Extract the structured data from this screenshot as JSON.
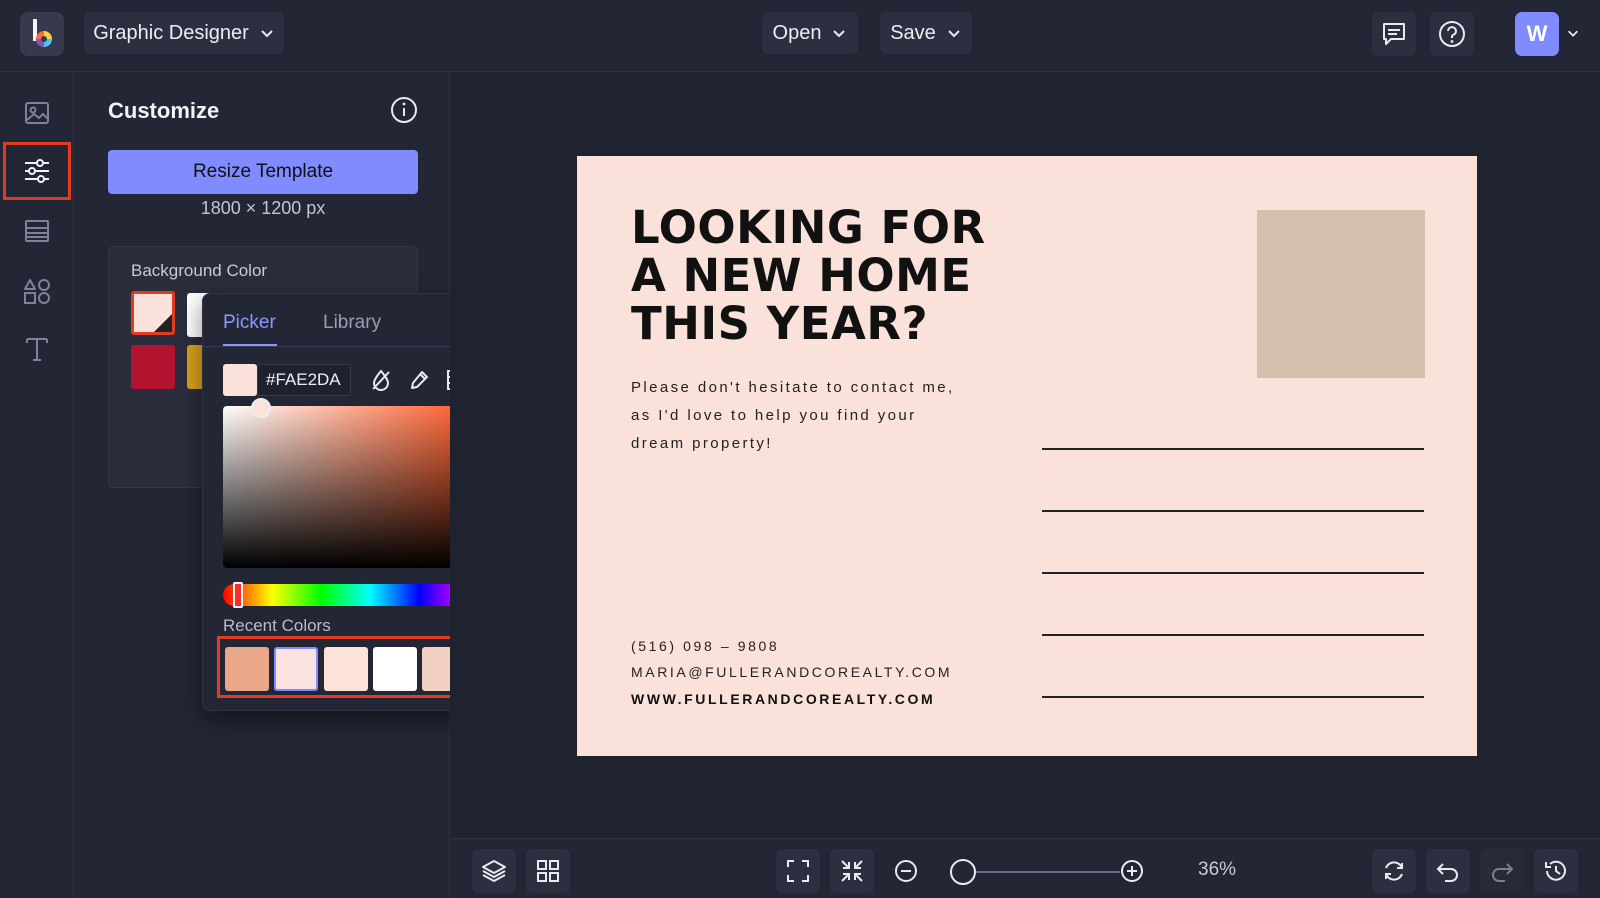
{
  "header": {
    "workspace_label": "Graphic Designer",
    "open_label": "Open",
    "save_label": "Save",
    "avatar_initial": "W"
  },
  "panel": {
    "title": "Customize",
    "resize_button": "Resize Template",
    "dimensions": "1800 × 1200 px",
    "background_label": "Background Color",
    "swatches": [
      "#fae2da",
      "#ffffff",
      "#b3132e",
      "#d9a11b"
    ]
  },
  "picker": {
    "tabs": [
      "Picker",
      "Library"
    ],
    "hex_value": "#FAE2DA",
    "recent_label": "Recent Colors",
    "recent_colors": [
      "#e9a889",
      "#f9e2e0",
      "#fde2d8",
      "#ffffff",
      "#f3cfc2",
      "#8a8a8a"
    ],
    "hue_position": 0.02,
    "sv_position": {
      "saturation": 0.14,
      "brightness": 0.98
    }
  },
  "postcard": {
    "headline": "LOOKING FOR\nA NEW HOME\nTHIS YEAR?",
    "body": "Please don't hesitate to contact me, as I'd love to help you find your dream property!",
    "phone": "(516) 098 – 9808",
    "email": "MARIA@FULLERANDCOREALTY.COM",
    "website": "WWW.FULLERANDCOREALTY.COM",
    "background": "#fae2da",
    "photo_color": "#d5bfad"
  },
  "footer": {
    "zoom_label": "36%",
    "zoom_value": 0.36
  },
  "colors": {
    "accent": "#7f8bff",
    "highlight": "#e33a22"
  }
}
